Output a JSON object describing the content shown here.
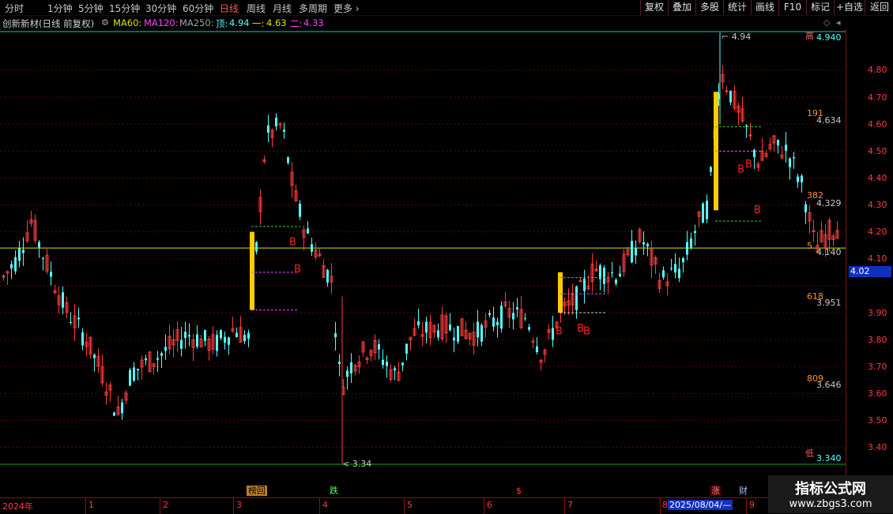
{
  "toolbar": {
    "periods": [
      "分时",
      "1分钟",
      "5分钟",
      "15分钟",
      "30分钟",
      "60分钟",
      "日线",
      "周线",
      "月线",
      "多周期",
      "更多"
    ],
    "active_period": "日线",
    "right_buttons": [
      "复权",
      "叠加",
      "多股",
      "统计",
      "画线",
      "F10",
      "标记",
      "+自选",
      "返回"
    ]
  },
  "info": {
    "stock": "创新新材(日线 前复权)",
    "ma60": "MA60:",
    "ma120": "MA120:",
    "ma250": "MA250:",
    "top_label": "顶:",
    "top_value": "4.94",
    "one_label": "一:",
    "one_value": "4.63",
    "two_label": "二:",
    "two_value": "4.33"
  },
  "price_axis": [
    "4.80",
    "4.70",
    "4.60",
    "4.50",
    "4.40",
    "4.30",
    "4.20",
    "4.10",
    "4.00",
    "3.90",
    "3.80",
    "3.70",
    "3.60",
    "3.50",
    "3.40"
  ],
  "current_price": "4.02",
  "fib_levels": [
    {
      "tag": "高",
      "value": "4.940"
    },
    {
      "tag": "191",
      "value": "4.634"
    },
    {
      "tag": "382",
      "value": "4.329"
    },
    {
      "tag": "5",
      "value": "4.140"
    },
    {
      "tag": "618",
      "value": "3.951"
    },
    {
      "tag": "809",
      "value": "3.646"
    },
    {
      "tag": "低",
      "value": "3.340"
    }
  ],
  "annotations": {
    "high_price": "4.94",
    "low_price": "3.34",
    "buy_signal": "B"
  },
  "dates": [
    "2024年",
    "1",
    "2",
    "3",
    "4",
    "5",
    "6",
    "7",
    "8",
    "9"
  ],
  "selected_date": "2025/08/04/—",
  "event_markers": [
    "榜回",
    "跌",
    "$",
    "涨",
    "财"
  ],
  "watermark": {
    "line1": "指标公式网",
    "line2": "www.zbgs3.com"
  },
  "colors": {
    "up": "#ff3b3b",
    "down": "#54ffff",
    "background": "#000000",
    "signal_bar": "#ffcc00",
    "buy": "#ff2020",
    "ma60": "#e0e000",
    "low_line": "#00b000",
    "high_line": "#00cccc"
  }
}
